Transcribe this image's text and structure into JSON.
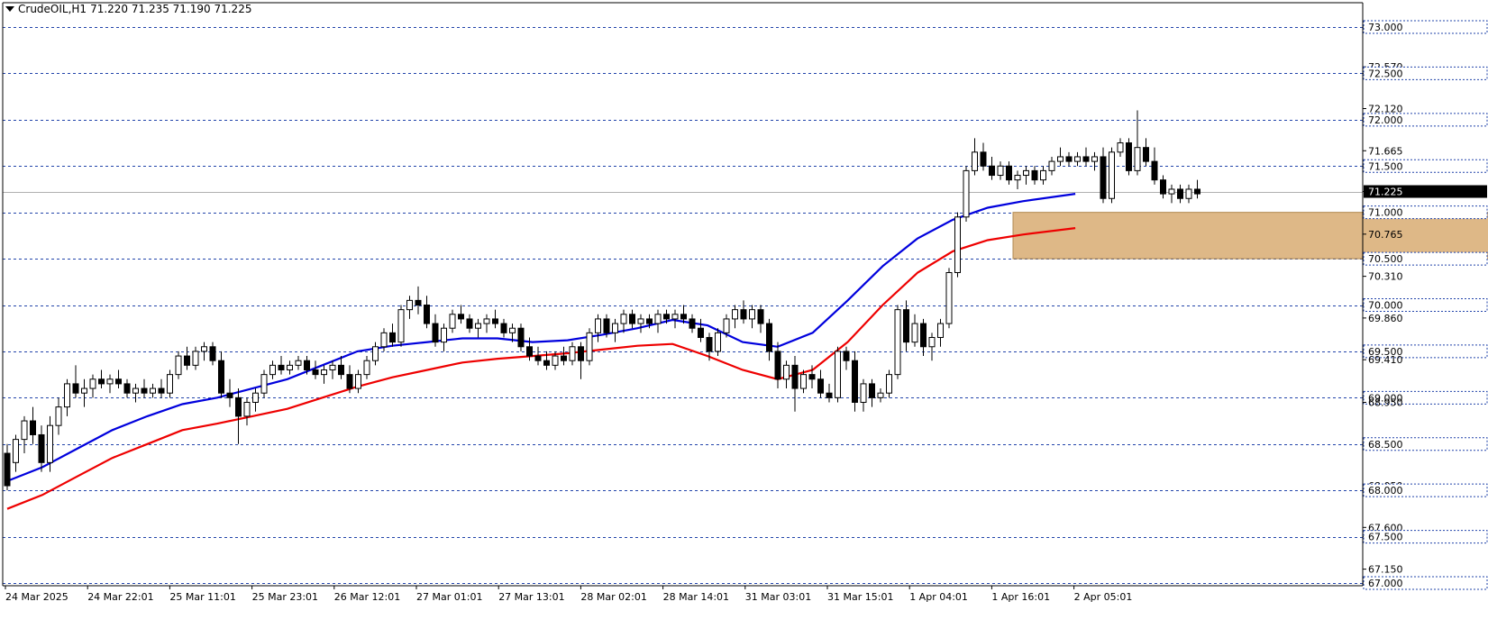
{
  "header": {
    "symbol": "CrudeOIL,H1",
    "ohlc": "71.220 71.235 71.190 71.225"
  },
  "chart_data": {
    "type": "candlestick",
    "ylim": [
      67.0,
      73.1
    ],
    "grid_levels": [
      73.0,
      72.5,
      72.0,
      71.5,
      71.0,
      70.5,
      70.0,
      69.5,
      69.0,
      68.5,
      68.0,
      67.5,
      67.0
    ],
    "y_ticks": [
      "73.000",
      "72.570",
      "72.500",
      "72.120",
      "72.000",
      "71.665",
      "71.500",
      "71.225",
      "71.000",
      "70.765",
      "70.500",
      "70.310",
      "70.000",
      "69.860",
      "69.500",
      "69.410",
      "69.000",
      "68.950",
      "68.500",
      "68.050",
      "68.000",
      "67.600",
      "67.500",
      "67.150",
      "67.000"
    ],
    "highlighted_ticks": [
      "73.000",
      "72.500",
      "72.000",
      "71.500",
      "71.000",
      "70.500",
      "70.000",
      "69.500",
      "69.000",
      "68.500",
      "68.000",
      "67.500",
      "67.000"
    ],
    "current_price": 71.225,
    "x_labels": [
      "24 Mar 2025",
      "24 Mar 22:01",
      "25 Mar 11:01",
      "25 Mar 23:01",
      "26 Mar 12:01",
      "27 Mar 01:01",
      "27 Mar 13:01",
      "28 Mar 02:01",
      "28 Mar 14:01",
      "31 Mar 03:01",
      "31 Mar 15:01",
      "1 Apr 04:01",
      "1 Apr 16:01",
      "2 Apr 05:01"
    ],
    "zone": {
      "from_bar": 118,
      "to_bar": 174,
      "low": 70.5,
      "high": 71.0,
      "color": "#deb887"
    },
    "ma_fast": {
      "color": "#0000dd",
      "points": [
        [
          0,
          68.1
        ],
        [
          10,
          68.25
        ],
        [
          20,
          68.45
        ],
        [
          30,
          68.65
        ],
        [
          40,
          68.8
        ],
        [
          50,
          68.93
        ],
        [
          60,
          69.0
        ],
        [
          70,
          69.1
        ],
        [
          80,
          69.2
        ],
        [
          90,
          69.35
        ],
        [
          100,
          69.5
        ],
        [
          110,
          69.56
        ],
        [
          120,
          69.6
        ],
        [
          130,
          69.64
        ],
        [
          140,
          69.64
        ],
        [
          150,
          69.6
        ],
        [
          160,
          69.62
        ],
        [
          170,
          69.68
        ],
        [
          180,
          69.75
        ],
        [
          190,
          69.84
        ],
        [
          200,
          69.78
        ],
        [
          210,
          69.6
        ],
        [
          220,
          69.55
        ],
        [
          230,
          69.7
        ],
        [
          240,
          70.05
        ],
        [
          250,
          70.42
        ],
        [
          260,
          70.72
        ],
        [
          270,
          70.92
        ],
        [
          280,
          71.05
        ],
        [
          290,
          71.12
        ],
        [
          305,
          71.2
        ]
      ]
    },
    "ma_slow": {
      "color": "#ee0000",
      "points": [
        [
          0,
          67.8
        ],
        [
          10,
          67.95
        ],
        [
          20,
          68.15
        ],
        [
          30,
          68.35
        ],
        [
          40,
          68.5
        ],
        [
          50,
          68.65
        ],
        [
          60,
          68.72
        ],
        [
          70,
          68.8
        ],
        [
          80,
          68.88
        ],
        [
          90,
          69.0
        ],
        [
          100,
          69.12
        ],
        [
          110,
          69.22
        ],
        [
          120,
          69.3
        ],
        [
          130,
          69.38
        ],
        [
          140,
          69.42
        ],
        [
          150,
          69.45
        ],
        [
          160,
          69.48
        ],
        [
          170,
          69.52
        ],
        [
          180,
          69.56
        ],
        [
          190,
          69.58
        ],
        [
          200,
          69.45
        ],
        [
          210,
          69.3
        ],
        [
          220,
          69.2
        ],
        [
          230,
          69.3
        ],
        [
          240,
          69.6
        ],
        [
          250,
          70.0
        ],
        [
          260,
          70.35
        ],
        [
          270,
          70.58
        ],
        [
          280,
          70.7
        ],
        [
          290,
          70.76
        ],
        [
          305,
          70.83
        ]
      ]
    },
    "candles": [
      [
        68.4,
        68.5,
        68.0,
        68.05
      ],
      [
        68.3,
        68.6,
        68.2,
        68.55
      ],
      [
        68.55,
        68.8,
        68.4,
        68.75
      ],
      [
        68.75,
        68.9,
        68.5,
        68.6
      ],
      [
        68.6,
        68.7,
        68.2,
        68.3
      ],
      [
        68.3,
        68.8,
        68.2,
        68.7
      ],
      [
        68.7,
        69.0,
        68.6,
        68.9
      ],
      [
        68.9,
        69.2,
        68.8,
        69.15
      ],
      [
        69.15,
        69.35,
        69.0,
        69.05
      ],
      [
        69.05,
        69.2,
        68.9,
        69.1
      ],
      [
        69.1,
        69.25,
        69.0,
        69.2
      ],
      [
        69.2,
        69.3,
        69.1,
        69.15
      ],
      [
        69.15,
        69.25,
        69.05,
        69.2
      ],
      [
        69.2,
        69.3,
        69.1,
        69.15
      ],
      [
        69.15,
        69.2,
        69.0,
        69.05
      ],
      [
        69.05,
        69.15,
        68.95,
        69.1
      ],
      [
        69.1,
        69.2,
        69.0,
        69.05
      ],
      [
        69.05,
        69.15,
        69.0,
        69.1
      ],
      [
        69.1,
        69.2,
        69.0,
        69.05
      ],
      [
        69.05,
        69.3,
        69.0,
        69.25
      ],
      [
        69.25,
        69.5,
        69.2,
        69.45
      ],
      [
        69.45,
        69.55,
        69.3,
        69.35
      ],
      [
        69.35,
        69.55,
        69.3,
        69.5
      ],
      [
        69.5,
        69.6,
        69.4,
        69.55
      ],
      [
        69.55,
        69.6,
        69.35,
        69.4
      ],
      [
        69.4,
        69.5,
        69.0,
        69.05
      ],
      [
        69.05,
        69.2,
        68.9,
        69.0
      ],
      [
        69.0,
        69.1,
        68.5,
        68.8
      ],
      [
        68.8,
        69.0,
        68.7,
        68.95
      ],
      [
        68.95,
        69.1,
        68.85,
        69.05
      ],
      [
        69.05,
        69.3,
        69.0,
        69.25
      ],
      [
        69.25,
        69.4,
        69.2,
        69.35
      ],
      [
        69.35,
        69.45,
        69.25,
        69.3
      ],
      [
        69.3,
        69.4,
        69.25,
        69.35
      ],
      [
        69.35,
        69.45,
        69.3,
        69.4
      ],
      [
        69.4,
        69.45,
        69.25,
        69.3
      ],
      [
        69.3,
        69.4,
        69.2,
        69.25
      ],
      [
        69.25,
        69.35,
        69.15,
        69.3
      ],
      [
        69.3,
        69.4,
        69.2,
        69.35
      ],
      [
        69.35,
        69.45,
        69.2,
        69.25
      ],
      [
        69.25,
        69.35,
        69.05,
        69.1
      ],
      [
        69.1,
        69.3,
        69.05,
        69.25
      ],
      [
        69.25,
        69.45,
        69.2,
        69.4
      ],
      [
        69.4,
        69.6,
        69.35,
        69.55
      ],
      [
        69.55,
        69.75,
        69.5,
        69.7
      ],
      [
        69.7,
        69.8,
        69.55,
        69.6
      ],
      [
        69.6,
        70.0,
        69.55,
        69.95
      ],
      [
        69.95,
        70.1,
        69.85,
        70.05
      ],
      [
        70.05,
        70.2,
        69.9,
        70.0
      ],
      [
        70.0,
        70.1,
        69.75,
        69.8
      ],
      [
        69.8,
        69.9,
        69.55,
        69.6
      ],
      [
        69.6,
        69.8,
        69.5,
        69.75
      ],
      [
        69.75,
        69.95,
        69.7,
        69.9
      ],
      [
        69.9,
        70.0,
        69.8,
        69.85
      ],
      [
        69.85,
        69.9,
        69.7,
        69.75
      ],
      [
        69.75,
        69.85,
        69.65,
        69.8
      ],
      [
        69.8,
        69.9,
        69.7,
        69.85
      ],
      [
        69.85,
        69.95,
        69.75,
        69.8
      ],
      [
        69.8,
        69.85,
        69.65,
        69.7
      ],
      [
        69.7,
        69.8,
        69.6,
        69.75
      ],
      [
        69.75,
        69.8,
        69.5,
        69.55
      ],
      [
        69.55,
        69.65,
        69.4,
        69.45
      ],
      [
        69.45,
        69.55,
        69.35,
        69.4
      ],
      [
        69.4,
        69.5,
        69.3,
        69.35
      ],
      [
        69.35,
        69.5,
        69.3,
        69.45
      ],
      [
        69.45,
        69.55,
        69.35,
        69.4
      ],
      [
        69.4,
        69.6,
        69.35,
        69.55
      ],
      [
        69.55,
        69.6,
        69.2,
        69.4
      ],
      [
        69.4,
        69.75,
        69.35,
        69.7
      ],
      [
        69.7,
        69.9,
        69.6,
        69.85
      ],
      [
        69.85,
        69.9,
        69.65,
        69.7
      ],
      [
        69.7,
        69.85,
        69.6,
        69.8
      ],
      [
        69.8,
        69.95,
        69.7,
        69.9
      ],
      [
        69.9,
        69.95,
        69.75,
        69.8
      ],
      [
        69.8,
        69.9,
        69.7,
        69.85
      ],
      [
        69.85,
        69.9,
        69.75,
        69.8
      ],
      [
        69.8,
        69.95,
        69.7,
        69.9
      ],
      [
        69.9,
        69.95,
        69.8,
        69.85
      ],
      [
        69.85,
        69.95,
        69.75,
        69.9
      ],
      [
        69.9,
        70.0,
        69.8,
        69.85
      ],
      [
        69.85,
        69.9,
        69.7,
        69.75
      ],
      [
        69.75,
        69.85,
        69.6,
        69.65
      ],
      [
        69.65,
        69.7,
        69.4,
        69.5
      ],
      [
        69.5,
        69.75,
        69.45,
        69.7
      ],
      [
        69.7,
        69.9,
        69.65,
        69.85
      ],
      [
        69.85,
        70.0,
        69.75,
        69.95
      ],
      [
        69.95,
        70.05,
        69.8,
        69.85
      ],
      [
        69.85,
        70.0,
        69.75,
        69.95
      ],
      [
        69.95,
        70.0,
        69.7,
        69.8
      ],
      [
        69.8,
        69.85,
        69.4,
        69.5
      ],
      [
        69.5,
        69.6,
        69.1,
        69.2
      ],
      [
        69.2,
        69.4,
        69.1,
        69.35
      ],
      [
        69.35,
        69.45,
        68.85,
        69.1
      ],
      [
        69.1,
        69.3,
        69.05,
        69.25
      ],
      [
        69.25,
        69.35,
        69.1,
        69.2
      ],
      [
        69.2,
        69.3,
        69.0,
        69.05
      ],
      [
        69.05,
        69.15,
        68.95,
        69.0
      ],
      [
        69.0,
        69.55,
        68.95,
        69.5
      ],
      [
        69.5,
        69.55,
        69.3,
        69.4
      ],
      [
        69.4,
        69.5,
        68.85,
        68.95
      ],
      [
        68.95,
        69.2,
        68.85,
        69.15
      ],
      [
        69.15,
        69.2,
        68.9,
        69.0
      ],
      [
        69.0,
        69.1,
        68.95,
        69.05
      ],
      [
        69.05,
        69.3,
        69.0,
        69.25
      ],
      [
        69.25,
        70.0,
        69.2,
        69.95
      ],
      [
        69.95,
        70.05,
        69.5,
        69.6
      ],
      [
        69.6,
        69.9,
        69.55,
        69.8
      ],
      [
        69.8,
        69.85,
        69.45,
        69.55
      ],
      [
        69.55,
        69.7,
        69.4,
        69.65
      ],
      [
        69.65,
        69.85,
        69.55,
        69.8
      ],
      [
        69.8,
        70.4,
        69.75,
        70.35
      ],
      [
        70.35,
        71.0,
        70.3,
        70.95
      ],
      [
        70.95,
        71.5,
        70.9,
        71.45
      ],
      [
        71.45,
        71.8,
        71.4,
        71.65
      ],
      [
        71.65,
        71.75,
        71.45,
        71.5
      ],
      [
        71.5,
        71.6,
        71.35,
        71.4
      ],
      [
        71.4,
        71.55,
        71.35,
        71.5
      ],
      [
        71.5,
        71.55,
        71.3,
        71.35
      ],
      [
        71.35,
        71.45,
        71.25,
        71.4
      ],
      [
        71.4,
        71.5,
        71.3,
        71.45
      ],
      [
        71.45,
        71.5,
        71.3,
        71.35
      ],
      [
        71.35,
        71.5,
        71.3,
        71.45
      ],
      [
        71.45,
        71.6,
        71.4,
        71.55
      ],
      [
        71.55,
        71.7,
        71.5,
        71.6
      ],
      [
        71.6,
        71.65,
        71.5,
        71.55
      ],
      [
        71.55,
        71.65,
        71.5,
        71.6
      ],
      [
        71.6,
        71.7,
        71.5,
        71.55
      ],
      [
        71.55,
        71.65,
        71.45,
        71.6
      ],
      [
        71.6,
        71.7,
        71.1,
        71.15
      ],
      [
        71.15,
        71.7,
        71.1,
        71.65
      ],
      [
        71.65,
        71.8,
        71.6,
        71.75
      ],
      [
        71.75,
        71.8,
        71.4,
        71.45
      ],
      [
        71.45,
        72.1,
        71.4,
        71.7
      ],
      [
        71.7,
        71.8,
        71.5,
        71.55
      ],
      [
        71.55,
        71.7,
        71.3,
        71.35
      ],
      [
        71.35,
        71.4,
        71.15,
        71.2
      ],
      [
        71.2,
        71.3,
        71.1,
        71.25
      ],
      [
        71.25,
        71.3,
        71.1,
        71.15
      ],
      [
        71.15,
        71.3,
        71.1,
        71.25
      ],
      [
        71.25,
        71.35,
        71.15,
        71.2
      ]
    ]
  }
}
